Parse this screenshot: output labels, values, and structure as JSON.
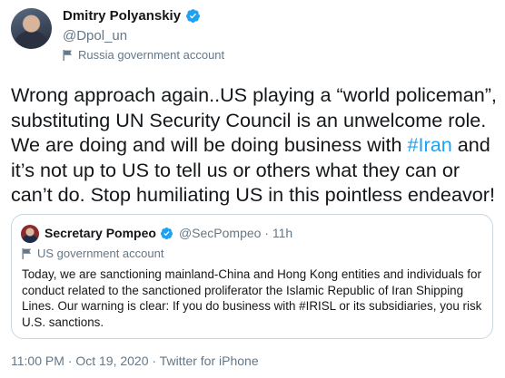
{
  "author": {
    "name": "Dmitry Polyanskiy",
    "handle": "@Dpol_un",
    "label": "Russia government account",
    "verified_icon": "verified-badge-icon"
  },
  "tweet": {
    "text_before": "Wrong approach again..US playing a “world policeman”, substituting UN Security Council is an unwelcome role. We are doing and will be doing business with ",
    "hashtag": "#Iran",
    "text_after": " and it’s not up to US to tell us or others what they can or can’t do. Stop humiliating US in this pointless endeavor!"
  },
  "quoted": {
    "name": "Secretary Pompeo",
    "handle": "@SecPompeo · 11h",
    "label": "US government account",
    "text": "Today, we are sanctioning mainland-China and Hong Kong entities and individuals for conduct related to the sanctioned proliferator the Islamic Republic of Iran Shipping Lines. Our warning is clear: If you do business with #IRISL or its subsidiaries, you risk U.S. sanctions."
  },
  "meta": {
    "timestamp": "11:00 PM · Oct 19, 2020 · Twitter for iPhone"
  },
  "colors": {
    "link": "#1da1f2",
    "secondary_text": "#657786",
    "border": "#ccd6dd"
  }
}
